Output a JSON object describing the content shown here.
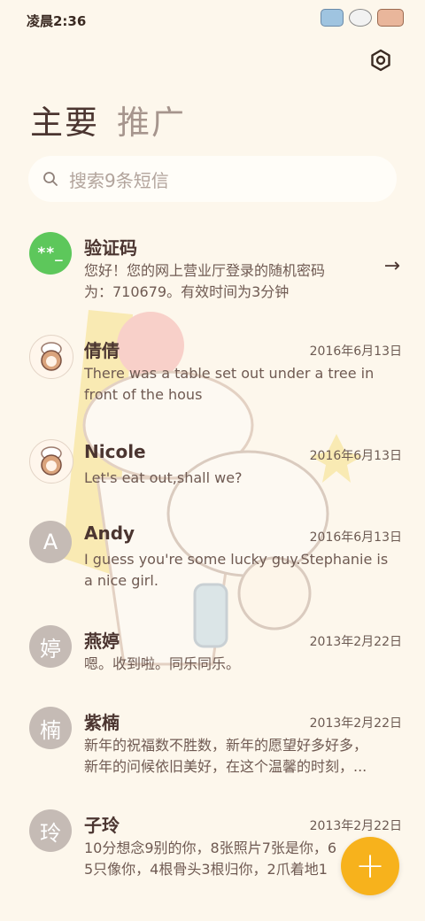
{
  "status": {
    "time": "凌晨2:36"
  },
  "tabs": [
    {
      "label": "主要"
    },
    {
      "label": "推广"
    }
  ],
  "search": {
    "placeholder": "搜索9条短信"
  },
  "messages": [
    {
      "avatar": "**_",
      "name": "验证码",
      "date": "",
      "line1": "您好！您的网上营业厅登录的随机密码",
      "line2": "为：710679。有效时间为3分钟",
      "arrow": "→"
    },
    {
      "avatar": "chef",
      "name": "倩倩",
      "date": "2016年6月13日",
      "line1": "There was a table set out under a tree in",
      "line2": "front of the hous"
    },
    {
      "avatar": "chef",
      "name": "Nicole",
      "date": "2016年6月13日",
      "line1": "Let's eat out,shall we?",
      "line2": ""
    },
    {
      "avatar": "A",
      "name": "Andy",
      "date": "2016年6月13日",
      "line1": "I guess you're some lucky guy.Stephanie is",
      "line2": "a nice girl."
    },
    {
      "avatar": "婷",
      "name": "燕婷",
      "date": "2013年2月22日",
      "line1": "嗯。收到啦。同乐同乐。",
      "line2": ""
    },
    {
      "avatar": "楠",
      "name": "紫楠",
      "date": "2013年2月22日",
      "line1": "新年的祝福数不胜数，新年的愿望好多好多，",
      "line2": "新年的问候依旧美好，在这个温馨的时刻，..."
    },
    {
      "avatar": "玲",
      "name": "子玲",
      "date": "2013年2月22日",
      "line1": "10分想念9别的你，8张照片7张是你，6",
      "line2": "5只像你，4根骨头3根归你，2爪着地1"
    }
  ],
  "fab": {
    "label": "+"
  },
  "colors": {
    "accent": "#f7b21c",
    "code_avatar": "#5dc75b",
    "letter_avatar": "#c5bbb5"
  }
}
